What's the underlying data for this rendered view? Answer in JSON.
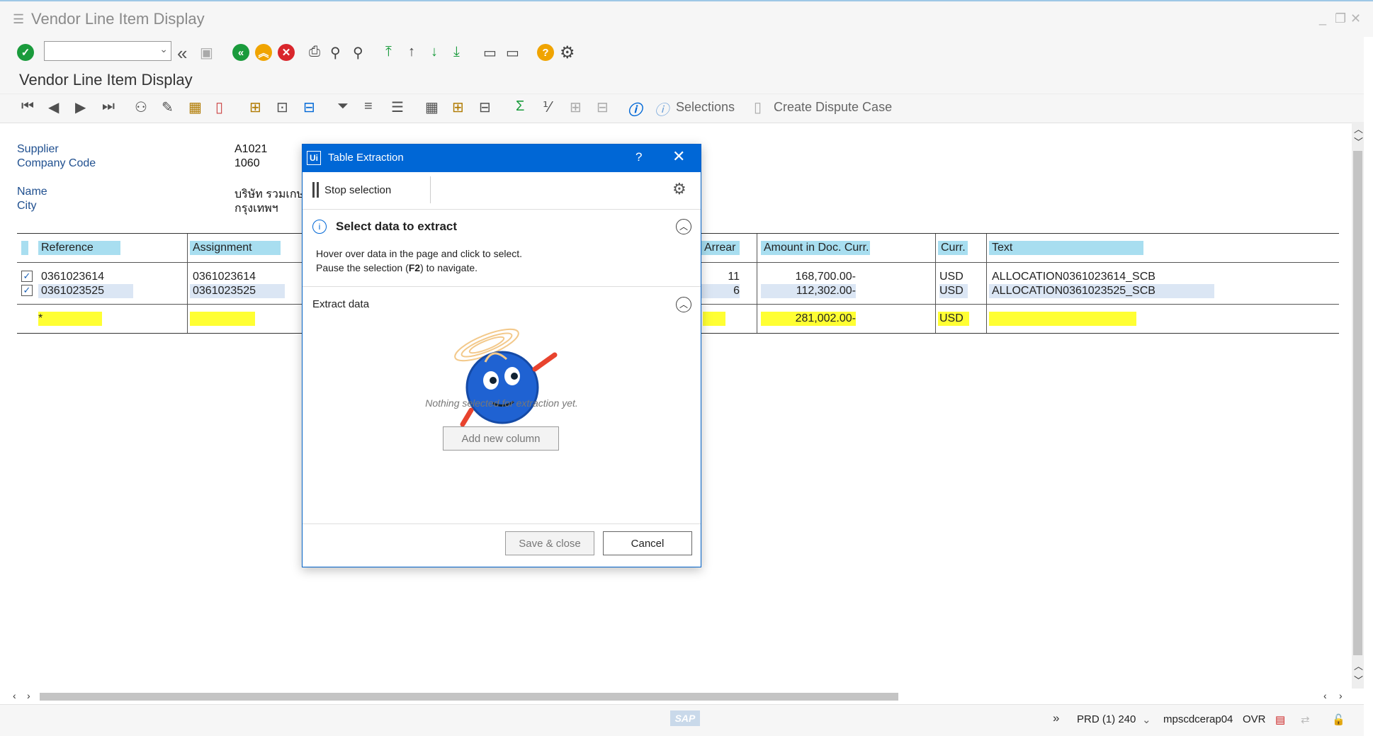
{
  "window": {
    "title": "Vendor Line Item Display"
  },
  "screen_title": "Vendor Line Item Display",
  "toolbar2": {
    "selections_label": "Selections",
    "create_dispute_label": "Create Dispute Case"
  },
  "header_fields": {
    "supplier_label": "Supplier",
    "supplier_value": "A1021",
    "company_code_label": "Company Code",
    "company_code_value": "1060",
    "name_label": "Name",
    "name_value": "บริษัท รวมเกษ",
    "city_label": "City",
    "city_value": "กรุงเทพฯ"
  },
  "grid": {
    "columns": [
      "Reference",
      "Assignment",
      "Arrear",
      "Amount in Doc. Curr.",
      "Curr.",
      "Text"
    ],
    "rows": [
      {
        "reference": "0361023614",
        "assignment": "0361023614",
        "arrear": "11",
        "amount": "168,700.00-",
        "curr": "USD",
        "text": "ALLOCATION0361023614_SCB"
      },
      {
        "reference": "0361023525",
        "assignment": "0361023525",
        "arrear": "6",
        "amount": "112,302.00-",
        "curr": "USD",
        "text": "ALLOCATION0361023525_SCB"
      }
    ],
    "total": {
      "marker": "*",
      "amount": "281,002.00-",
      "curr": "USD"
    }
  },
  "dialog": {
    "title": "Table Extraction",
    "help": "?",
    "close": "✕",
    "stop_selection_label": "Stop selection",
    "select_heading": "Select data to extract",
    "hint_line1": "Hover over data in the page and click to select.",
    "hint_line2_pre": "Pause the selection (",
    "hint_key": "F2",
    "hint_line2_post": ") to navigate.",
    "extract_heading": "Extract data",
    "empty_message": "Nothing selected for extraction yet.",
    "add_column_label": "Add new column",
    "save_close_label": "Save & close",
    "cancel_label": "Cancel"
  },
  "status": {
    "system": "PRD (1) 240",
    "server": "mpscdcerap04",
    "mode": "OVR",
    "sap_logo": "SAP"
  },
  "colors": {
    "accent": "#0067d6",
    "header_blue": "#a8def0",
    "total_yellow": "#ffff33"
  }
}
